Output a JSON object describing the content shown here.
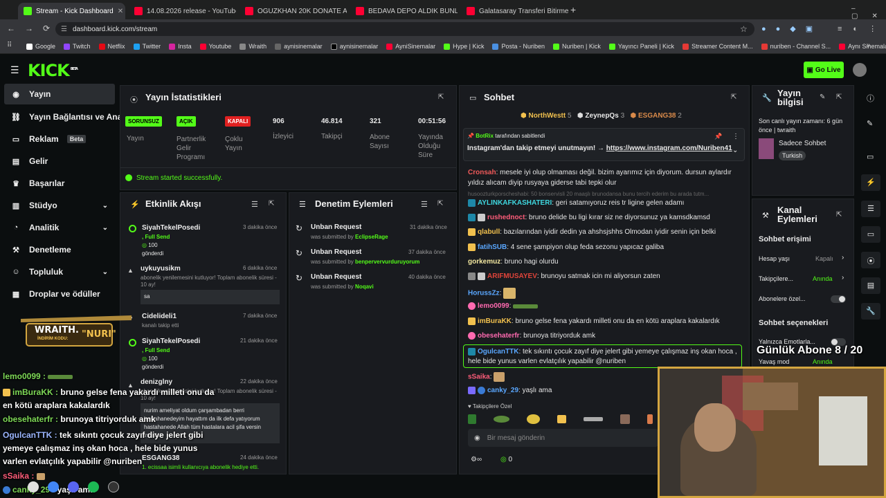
{
  "browser": {
    "tabs": [
      {
        "title": "Stream - Kick Dashboard",
        "fav": "k"
      },
      {
        "title": "14.08.2026 release - YouTube",
        "fav": "y"
      },
      {
        "title": "OGUZKHAN 20K DONATE ALIYO",
        "fav": "y"
      },
      {
        "title": "BEDAVA DEPO ALDIK BUNLAR AL",
        "fav": "y"
      },
      {
        "title": "Galatasaray Transferi Bitirmek İç",
        "fav": "y"
      }
    ],
    "url": "dashboard.kick.com/stream",
    "bookmarks": [
      "Google",
      "Twitch",
      "Netflix",
      "Twitter",
      "Insta",
      "Youtube",
      "Wraith",
      "aynisinemalar",
      "aynisinemalar",
      "AyniSinemalar",
      "Hype | Kick",
      "Posta - Nuriben",
      "Nuriben | Kick",
      "Yayıncı Paneli | Kick",
      "Streamer Content M...",
      "nuriben - Channel S...",
      "Aynı Sinemalar - Ça..."
    ]
  },
  "header": {
    "logo": "KICK",
    "beta": "BETA",
    "go_live": "Go Live"
  },
  "sidebar": {
    "items": [
      {
        "label": "Yayın",
        "icon": "broadcast-icon"
      },
      {
        "label": "Yayın Bağlantısı ve Anahtarı",
        "icon": "link-icon"
      },
      {
        "label": "Reklam",
        "icon": "ad-icon",
        "badge": "Beta"
      },
      {
        "label": "Gelir",
        "icon": "dollar-icon"
      },
      {
        "label": "Başarılar",
        "icon": "trophy-icon"
      },
      {
        "label": "Stüdyo",
        "icon": "studio-icon"
      },
      {
        "label": "Analitik",
        "icon": "chart-icon"
      },
      {
        "label": "Denetleme",
        "icon": "hammer-icon"
      },
      {
        "label": "Topluluk",
        "icon": "community-icon"
      },
      {
        "label": "Droplar ve ödüller",
        "icon": "gift-icon"
      }
    ]
  },
  "stats": {
    "title": "Yayın İstatistikleri",
    "cols": [
      {
        "badge": "SORUNSUZ",
        "label": "Yayın"
      },
      {
        "badge": "AÇIK",
        "label": "Partnerlik Gelir Programı"
      },
      {
        "badge": "KAPALI",
        "label": "Çoklu Yayın"
      },
      {
        "value": "906",
        "label": "İzleyici"
      },
      {
        "value": "46.814",
        "label": "Takipçi"
      },
      {
        "value": "321",
        "label": "Abone Sayısı"
      },
      {
        "value": "00:51:56",
        "label": "Yayında Olduğu Süre"
      }
    ],
    "success": "Stream started successfully."
  },
  "activity": {
    "title": "Etkinlik Akışı",
    "items": [
      {
        "name": "SiyahTekelPosedi",
        "time": "3 dakika önce",
        "extra": ", Full Send",
        "amount": "100",
        "sent": "gönderdi"
      },
      {
        "name": "uykuyusikm",
        "time": "6 dakika önce",
        "text": "abonelik yenilemesini kutluyor! Toplam abonelik süresi - 10 ay!",
        "msg": "sa"
      },
      {
        "name": "Cidelideli1",
        "time": "7 dakika önce",
        "text": "kanalı takip etti"
      },
      {
        "name": "SiyahTekelPosedi",
        "time": "21 dakika önce",
        "extra": ", Full Send",
        "amount": "100",
        "sent": "gönderdi"
      },
      {
        "name": "denizglny",
        "time": "22 dakika önce",
        "text": "abonelik yenilemesini kutluyor! Toplam abonelik süresi - 10 ay!",
        "msg": "nurim ameliyat oldum çarşambadan berri hastahanedeyim hayattım da ilk defa yatıyorum hastahanede Allah tüm hastalara acil şifa versin inşallah"
      },
      {
        "name": "ESGANG38",
        "time": "24 dakika önce",
        "text": "1. ecissaa isimli kullanıcıya abonelik hediye etti."
      }
    ]
  },
  "moderation": {
    "title": "Denetim Eylemleri",
    "items": [
      {
        "title": "Unban Request",
        "by": "was submitted by",
        "user": "EclipseRage",
        "time": "31 dakika önce"
      },
      {
        "title": "Unban Request",
        "by": "was submitted by",
        "user": "benpervervurduruyorum",
        "time": "37 dakika önce"
      },
      {
        "title": "Unban Request",
        "by": "was submitted by",
        "user": "Noqavi",
        "time": "40 dakika önce"
      }
    ]
  },
  "chat": {
    "title": "Sohbet",
    "top_gifters": [
      {
        "name": "NorthWestt",
        "count": "5"
      },
      {
        "name": "ZeynepQs",
        "count": "3"
      },
      {
        "name": "ESGANG38",
        "count": "2"
      }
    ],
    "pinned_by": "BotRix",
    "pinned_suffix": "tarafından sabitlendi",
    "pinned_text": "Instagram'dan takip etmeyi unutmayın! →",
    "pinned_link": "https://www.instagram.com/Nuriben41",
    "messages": [
      {
        "user": "Cronsah",
        "color": "#f05a5a",
        "text": "mesele iyi olup olmaması değil. bizim ayarımız için diyorum. dursun aylardır yıldız alıcam diyip rusyaya giderse tabi tepki olur"
      },
      {
        "user": "husoozturkporscheshabi",
        "color": "#666",
        "text": "50 bonservisli 20 maaşlı brunodansa bunu tercih ederim bu arada tutm..."
      },
      {
        "user": "AYLINKAFKASHATERI",
        "color": "#3fd8e0",
        "text": "geri satamıyoruz reis tr ligine gelen adamı"
      },
      {
        "user": "rushednoct",
        "color": "#ff5d7a",
        "text": "bruno delide bu ligi kırar siz ne diyorsunuz ya kamsdkamsd"
      },
      {
        "user": "qlabull",
        "color": "#f2c14e",
        "text": "bazılarından iyidir dedin ya ahshsjshhs Olmodan iyidir senin için belki"
      },
      {
        "user": "fatihSUB",
        "color": "#5aa7ff",
        "text": "4 sene şampiyon olup feda sezonu yapıcaz galiba"
      },
      {
        "user": "gorkemuz",
        "color": "#f2e7a0",
        "text": "bruno hagi olurdu"
      },
      {
        "user": "ARIFMUSAYEV",
        "color": "#e0443a",
        "text": "brunoyu satmak icin mi aliyorsun zaten"
      },
      {
        "user": "HorussZz",
        "color": "#5aa7ff",
        "text": ""
      },
      {
        "user": "lemo0099",
        "color": "#ff6ab0",
        "text": ""
      },
      {
        "user": "imBuraKK",
        "color": "#f2c14e",
        "text": "bruno gelse fena yakardı milleti onu da en kötü araplara kakalardık"
      },
      {
        "user": "obesehaterfr",
        "color": "#ff6ab0",
        "text": "brunoya titriyorduk amk"
      },
      {
        "user": "OgulcanTTK",
        "color": "#5aa7ff",
        "text": "tek sıkıntı çocuk zayıf diye jelert gibi yemeye çalışmaz inş okan hoca , hele bide yunus varlen evlatçılık yapabilir @nuriben"
      },
      {
        "user": "sSaika",
        "color": "#ff5d7a",
        "text": ""
      },
      {
        "user": "canky_29",
        "color": "#5aa7ff",
        "text": "yaşlı ama"
      }
    ],
    "followers_only": "Takipçilere Özel",
    "input_placeholder": "Bir mesaj gönderin",
    "footer_count": "0"
  },
  "stream_info": {
    "title": "Yayın bilgisi",
    "last_live": "Son canlı yayın zamanı: 6 gün önce | twraith",
    "category": "Sadece Sohbet",
    "tag": "Turkish"
  },
  "channel_actions": {
    "title": "Kanal Eylemleri",
    "chat_access": "Sohbet erişimi",
    "slow_mode": "Hesap yaşı",
    "slow_val": "Kapalı",
    "followers": "Takipçilere...",
    "followers_val": "Anında",
    "subs": "Abonelere özel...",
    "chat_opts": "Sohbet seçenekleri",
    "emotes": "Yalnızca Emotlarla...",
    "slow": "Yavaş mod",
    "slow_val2": "Anında"
  },
  "overlay": {
    "sponsor_name": "WRAITH.",
    "sponsor_code_label": "İNDİRİM KODU:",
    "sponsor_code": "\"NURI\"",
    "sub_goal": "Günlük Abone 8 / 20",
    "chat": [
      {
        "user": "lemo0099 :",
        "color": "#7ed957",
        "text": ""
      },
      {
        "user": "imBuraKK :",
        "color": "#7ed957",
        "text": "bruno gelse fena yakardı milleti onu da en kötü araplara kakalardık"
      },
      {
        "user": "obesehaterfr :",
        "color": "#7ed957",
        "text": "brunoya titriyorduk amk"
      },
      {
        "user": "OgulcanTTK :",
        "color": "#9bb6ff",
        "text": "tek sıkıntı çocuk zayıf diye jelert gibi yemeye çalışmaz inş okan hoca , hele bide yunus varlen evlatçılık yapabilir @nuriben"
      },
      {
        "user": "sSaika :",
        "color": "#ff5d7a",
        "text": ""
      },
      {
        "user": "canky_29 :",
        "color": "#7ed957",
        "text": "yaşlı ama"
      }
    ]
  }
}
